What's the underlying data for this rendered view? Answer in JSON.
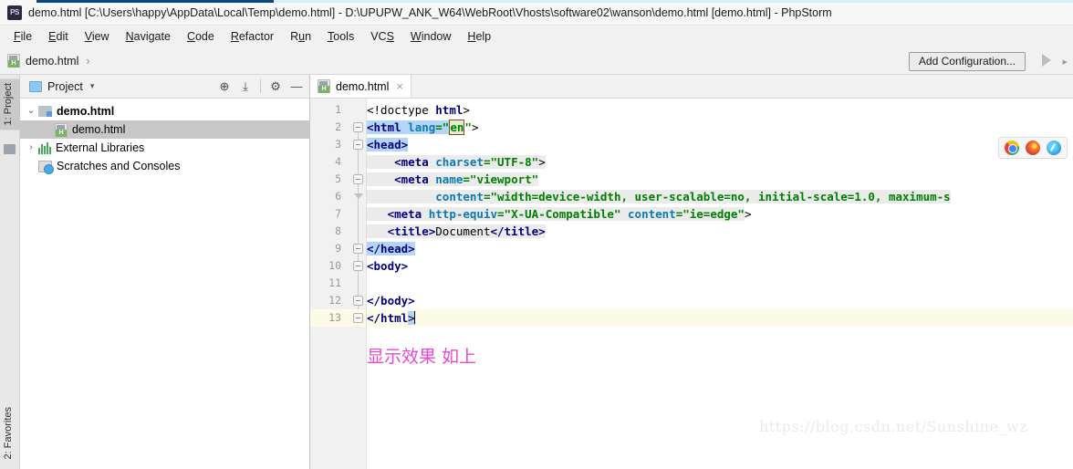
{
  "window": {
    "title": "demo.html [C:\\Users\\happy\\AppData\\Local\\Temp\\demo.html] - D:\\UPUPW_ANK_W64\\WebRoot\\Vhosts\\software02\\wanson\\demo.html [demo.html] - PhpStorm",
    "app_logo": "phpstorm-logo"
  },
  "menubar": {
    "items": [
      {
        "label": "File",
        "mnemonic": "F"
      },
      {
        "label": "Edit",
        "mnemonic": "E"
      },
      {
        "label": "View",
        "mnemonic": "V"
      },
      {
        "label": "Navigate",
        "mnemonic": "N"
      },
      {
        "label": "Code",
        "mnemonic": "C"
      },
      {
        "label": "Refactor",
        "mnemonic": "R"
      },
      {
        "label": "Run",
        "mnemonic": "u"
      },
      {
        "label": "Tools",
        "mnemonic": "T"
      },
      {
        "label": "VCS",
        "mnemonic": "S"
      },
      {
        "label": "Window",
        "mnemonic": "W"
      },
      {
        "label": "Help",
        "mnemonic": "H"
      }
    ]
  },
  "navbar": {
    "breadcrumb": "demo.html",
    "separator": "›",
    "add_configuration_label": "Add Configuration...",
    "run_icon": "run-play-icon",
    "more_icon": "chevron-right-icon"
  },
  "toolstrip": {
    "top_label": "1: Project",
    "bottom_label": "2: Favorites"
  },
  "project_panel": {
    "title": "Project",
    "caret": "▾",
    "tools": [
      {
        "name": "locate-icon",
        "glyph": "⊕"
      },
      {
        "name": "collapse-all-icon",
        "glyph": "⤓"
      },
      {
        "name": "settings-gear-icon",
        "glyph": "⚙"
      },
      {
        "name": "hide-panel-icon",
        "glyph": "—"
      }
    ],
    "tree": [
      {
        "label": "demo.html",
        "icon": "folder-icon",
        "twisty": "⌄",
        "indent": 0,
        "bold": true,
        "selected": false
      },
      {
        "label": "demo.html",
        "icon": "html-file-icon",
        "twisty": "",
        "indent": 1,
        "bold": false,
        "selected": true
      },
      {
        "label": "External Libraries",
        "icon": "library-icon",
        "twisty": "›",
        "indent": 0,
        "bold": false,
        "selected": false
      },
      {
        "label": "Scratches and Consoles",
        "icon": "scratches-icon",
        "twisty": "",
        "indent": 0,
        "bold": false,
        "selected": false
      }
    ]
  },
  "editor": {
    "tab": {
      "label": "demo.html",
      "icon": "html-file-icon",
      "close": "×"
    },
    "browsers": [
      {
        "name": "chrome-icon",
        "cls": "chrome"
      },
      {
        "name": "firefox-icon",
        "cls": "firefox"
      },
      {
        "name": "edge-icon",
        "cls": "edge"
      }
    ],
    "current_line": 13,
    "lines": [
      {
        "n": 1,
        "fold": "",
        "segs": [
          {
            "t": "<!doctype ",
            "c": "t-doct"
          },
          {
            "t": "html",
            "c": "t-tag"
          },
          {
            "t": ">",
            "c": "t-punct"
          }
        ]
      },
      {
        "n": 2,
        "fold": "box",
        "segs": [
          {
            "t": "<html",
            "c": "t-tag sel-blue"
          },
          {
            "t": " ",
            "c": "sel-blue"
          },
          {
            "t": "lang",
            "c": "t-attr sel-blue"
          },
          {
            "t": "=\"",
            "c": "t-val sel-blue"
          },
          {
            "t": "en",
            "c": "t-val err-box"
          },
          {
            "t": "\"",
            "c": "t-val"
          },
          {
            "t": ">",
            "c": "t-punct"
          }
        ]
      },
      {
        "n": 3,
        "fold": "box",
        "segs": [
          {
            "t": "<head>",
            "c": "t-tag sel-blue"
          }
        ]
      },
      {
        "n": 4,
        "fold": "",
        "segs": [
          {
            "t": "    ",
            "c": "hl-gray"
          },
          {
            "t": "<meta",
            "c": "t-tag hl-gray"
          },
          {
            "t": " ",
            "c": "hl-gray"
          },
          {
            "t": "charset",
            "c": "t-attr hl-gray"
          },
          {
            "t": "=\"UTF-8\"",
            "c": "t-val hl-gray"
          },
          {
            "t": ">",
            "c": "t-punct hl-gray"
          }
        ]
      },
      {
        "n": 5,
        "fold": "box",
        "segs": [
          {
            "t": "    ",
            "c": "hl-gray"
          },
          {
            "t": "<meta",
            "c": "t-tag hl-gray"
          },
          {
            "t": " ",
            "c": "hl-gray"
          },
          {
            "t": "name",
            "c": "t-attr hl-gray"
          },
          {
            "t": "=\"viewport\"",
            "c": "t-val hl-gray"
          }
        ]
      },
      {
        "n": 6,
        "fold": "tri",
        "segs": [
          {
            "t": "          ",
            "c": "hl-gray"
          },
          {
            "t": "content",
            "c": "t-attr hl-gray"
          },
          {
            "t": "=\"width=device-width, user-scalable=no, initial-scale=1.0, maximum-s",
            "c": "t-val hl-gray"
          }
        ]
      },
      {
        "n": 7,
        "fold": "",
        "segs": [
          {
            "t": "   ",
            "c": "hl-gray"
          },
          {
            "t": "<meta",
            "c": "t-tag hl-gray"
          },
          {
            "t": " ",
            "c": "hl-gray"
          },
          {
            "t": "http-equiv",
            "c": "t-attr hl-gray"
          },
          {
            "t": "=\"X-UA-Compatible\"",
            "c": "t-val hl-gray"
          },
          {
            "t": " ",
            "c": "hl-gray"
          },
          {
            "t": "content",
            "c": "t-attr hl-gray"
          },
          {
            "t": "=\"ie=edge\"",
            "c": "t-val hl-gray"
          },
          {
            "t": ">",
            "c": "t-punct"
          }
        ]
      },
      {
        "n": 8,
        "fold": "",
        "segs": [
          {
            "t": "   ",
            "c": "hl-gray"
          },
          {
            "t": "<title>",
            "c": "t-tag hl-gray"
          },
          {
            "t": "Document",
            "c": "t-text hl-gray"
          },
          {
            "t": "</title>",
            "c": "t-tag hl-gray"
          }
        ]
      },
      {
        "n": 9,
        "fold": "box",
        "segs": [
          {
            "t": "</head>",
            "c": "t-tag sel-blue"
          }
        ]
      },
      {
        "n": 10,
        "fold": "box",
        "segs": [
          {
            "t": "<body>",
            "c": "t-tag"
          }
        ]
      },
      {
        "n": 11,
        "fold": "",
        "segs": []
      },
      {
        "n": 12,
        "fold": "box",
        "segs": [
          {
            "t": "</body>",
            "c": "t-tag"
          }
        ]
      },
      {
        "n": 13,
        "fold": "box",
        "segs": [
          {
            "t": "</html",
            "c": "t-tag"
          },
          {
            "t": ">",
            "c": "t-punct sel-blue"
          }
        ]
      }
    ],
    "annotation": "显示效果 如上",
    "watermark": "https://blog.csdn.net/Sunshine_wz"
  },
  "colors": {
    "tag": "#000080",
    "attribute": "#0b7ab3",
    "value": "#008000",
    "selection": "#b4d5f7",
    "current_line": "#fdfae6",
    "annotation": "#e846d6",
    "error_border": "#a33b2a"
  }
}
